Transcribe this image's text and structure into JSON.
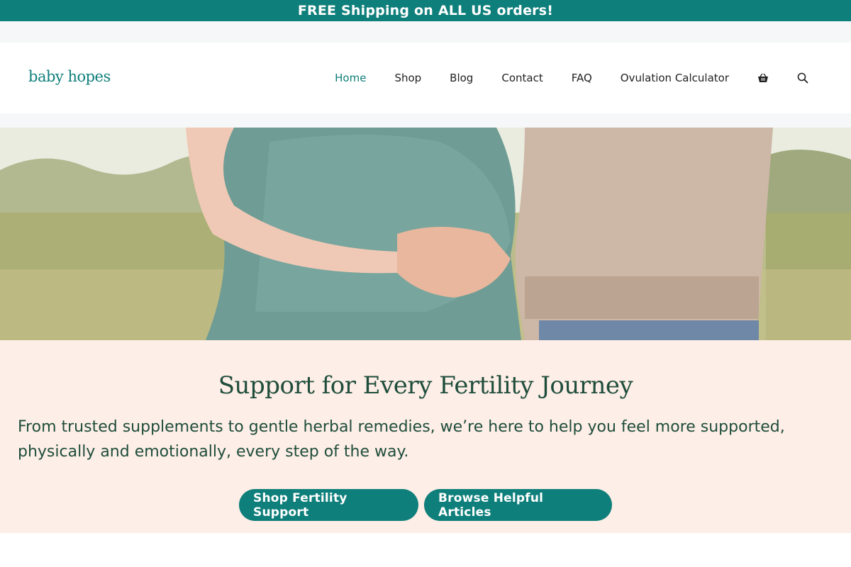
{
  "announcement": {
    "text": "FREE Shipping on ALL US orders!"
  },
  "header": {
    "logo": "baby hopes",
    "nav": [
      {
        "label": "Home",
        "active": true
      },
      {
        "label": "Shop",
        "active": false
      },
      {
        "label": "Blog",
        "active": false
      },
      {
        "label": "Contact",
        "active": false
      },
      {
        "label": "FAQ",
        "active": false
      },
      {
        "label": "Ovulation Calculator",
        "active": false
      }
    ],
    "icons": [
      "basket-icon",
      "search-icon"
    ]
  },
  "hero": {
    "image": "pregnant-couple-holding-hands-field"
  },
  "intro": {
    "title": "Support for Every Fertility Journey",
    "body": "From trusted supplements to gentle herbal remedies, we’re here to help you feel more supported, physically and emotionally, every step of the way.",
    "buttons": [
      {
        "label": "Shop Fertility Support"
      },
      {
        "label": "Browse Helpful Articles"
      }
    ]
  },
  "colors": {
    "accent": "#0f7f7b",
    "heading": "#1f4d3b",
    "intro_bg": "#fdeee7"
  }
}
